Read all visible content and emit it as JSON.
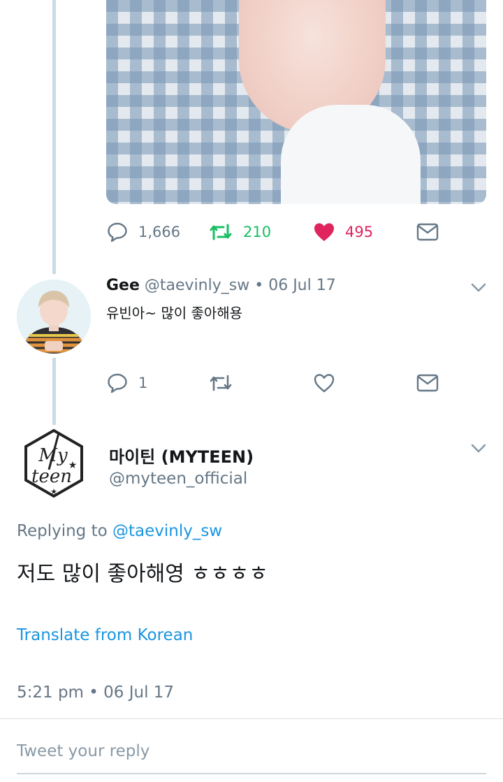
{
  "prev_tweet": {
    "actions": {
      "replies": "1,666",
      "retweets": "210",
      "likes": "495",
      "liked": true
    }
  },
  "reply_tweet": {
    "display_name": "Gee",
    "handle": "@taevinly_sw",
    "separator": "•",
    "date": "06 Jul 17",
    "text": "유빈아~ 많이 좋아해용",
    "actions": {
      "replies": "1"
    }
  },
  "main_tweet": {
    "display_name": "마이틴 (MYTEEN)",
    "handle": "@myteen_official",
    "replying_prefix": "Replying to",
    "replying_handle": "@taevinly_sw",
    "text": "저도 많이 좋아해영 ㅎㅎㅎㅎ",
    "translate_label": "Translate from Korean",
    "timestamp": "5:21 pm • 06 Jul 17",
    "logo_text": "My teen"
  },
  "composer": {
    "placeholder": "Tweet your reply"
  },
  "colors": {
    "retweet_green": "#17bf63",
    "like_pink": "#e0245e",
    "link_blue": "#1b95e0",
    "muted_gray": "#657786",
    "thread_line": "#c9dbe9"
  },
  "icons": [
    "reply-icon",
    "retweet-icon",
    "heart-icon",
    "dm-icon",
    "chevron-down-icon"
  ]
}
